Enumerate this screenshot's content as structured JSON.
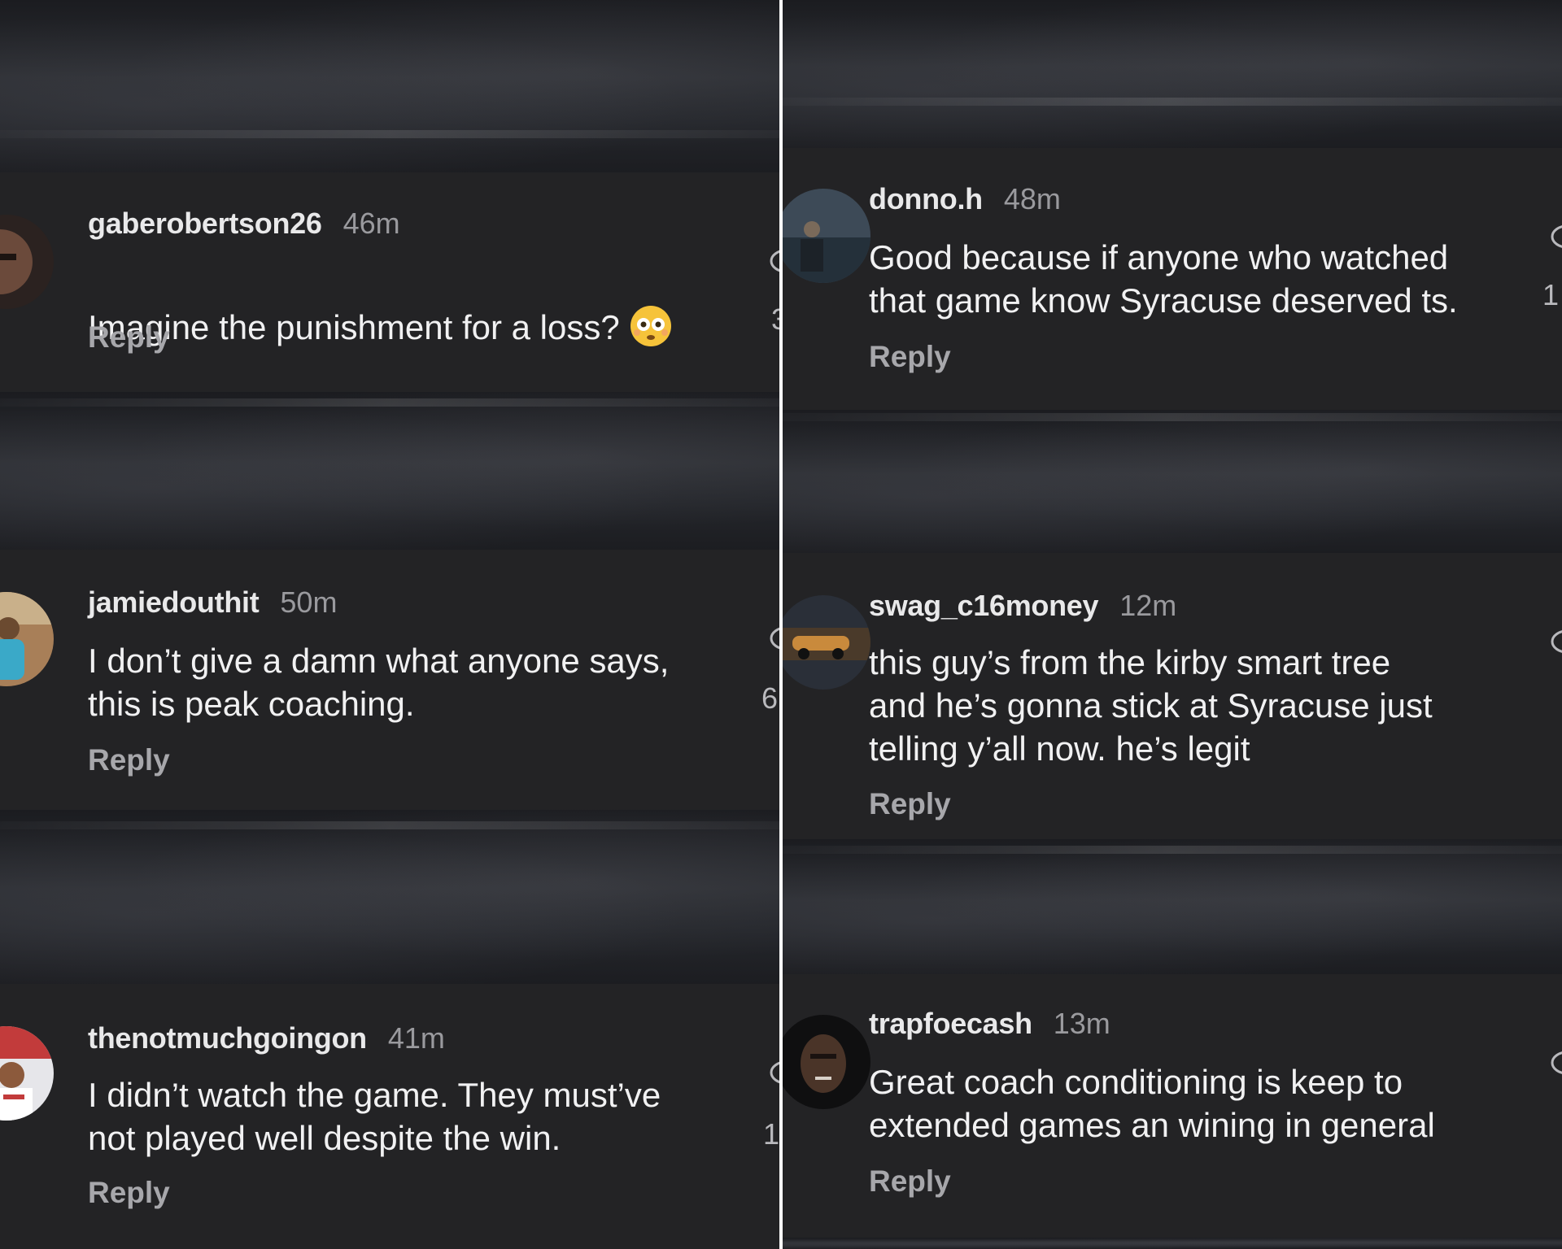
{
  "left_column": [
    {
      "username": "gaberobertson26",
      "time": "46m",
      "text": "Imagine the punishment for a loss?",
      "emoji": "flushed-face-emoji",
      "reply": "Reply",
      "side_count": "3"
    },
    {
      "username": "jamiedouthit",
      "time": "50m",
      "text": "I don’t give a damn what anyone says,\nthis is peak coaching.",
      "reply": "Reply",
      "side_count": "6"
    },
    {
      "username": "thenotmuchgoingon",
      "time": "41m",
      "text": "I didn’t watch the game. They must’ve\nnot played well despite the win.",
      "reply": "Reply",
      "side_count": "1"
    }
  ],
  "right_column": [
    {
      "username": "donno.h",
      "time": "48m",
      "text": "Good because if anyone who watched\nthat game know Syracuse deserved ts.",
      "reply": "Reply",
      "side_count": "1"
    },
    {
      "username": "swag_c16money",
      "time": "12m",
      "text": "this guy’s from the kirby smart tree\nand he’s gonna stick at Syracuse just\ntelling y’all now. he’s legit",
      "reply": "Reply"
    },
    {
      "username": "trapfoecash",
      "time": "13m",
      "text": "Great coach conditioning is keep to\nextended games an wining in general",
      "reply": "Reply"
    }
  ],
  "icons": {
    "like": "heart-outline-icon",
    "emoji": "flushed-face-emoji"
  },
  "colors": {
    "card_background": "#232325",
    "username": "#e9e9ea",
    "timestamp": "#9a9a9e",
    "comment_text": "#f1f1f2",
    "reply": "#a7a7ab",
    "divider": "#ffffff"
  }
}
